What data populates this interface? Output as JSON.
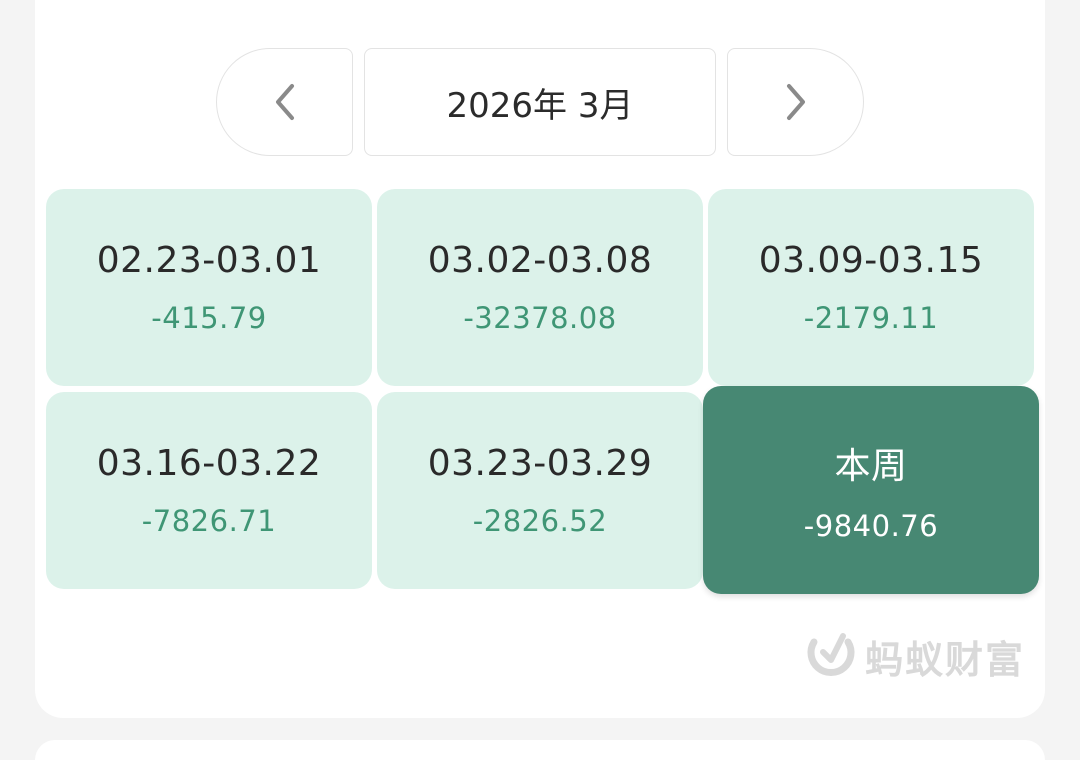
{
  "nav": {
    "month_label": "2026年 3月",
    "prev_icon": "chevron-left-icon",
    "next_icon": "chevron-right-icon"
  },
  "weeks": [
    {
      "range": "02.23-03.01",
      "amount": "-415.79"
    },
    {
      "range": "03.02-03.08",
      "amount": "-32378.08"
    },
    {
      "range": "03.09-03.15",
      "amount": "-2179.11"
    },
    {
      "range": "03.16-03.22",
      "amount": "-7826.71"
    },
    {
      "range": "03.23-03.29",
      "amount": "-2826.52"
    },
    {
      "range": "本周",
      "amount": "-9840.76",
      "selected": true
    }
  ],
  "watermark": {
    "text": "蚂蚁财富",
    "icon": "ant-fortune-logo-icon"
  },
  "colors": {
    "cell_bg": "#dcf2ea",
    "cell_amount": "#3f9675",
    "active_bg": "#478873",
    "page_bg": "#f4f4f4"
  }
}
